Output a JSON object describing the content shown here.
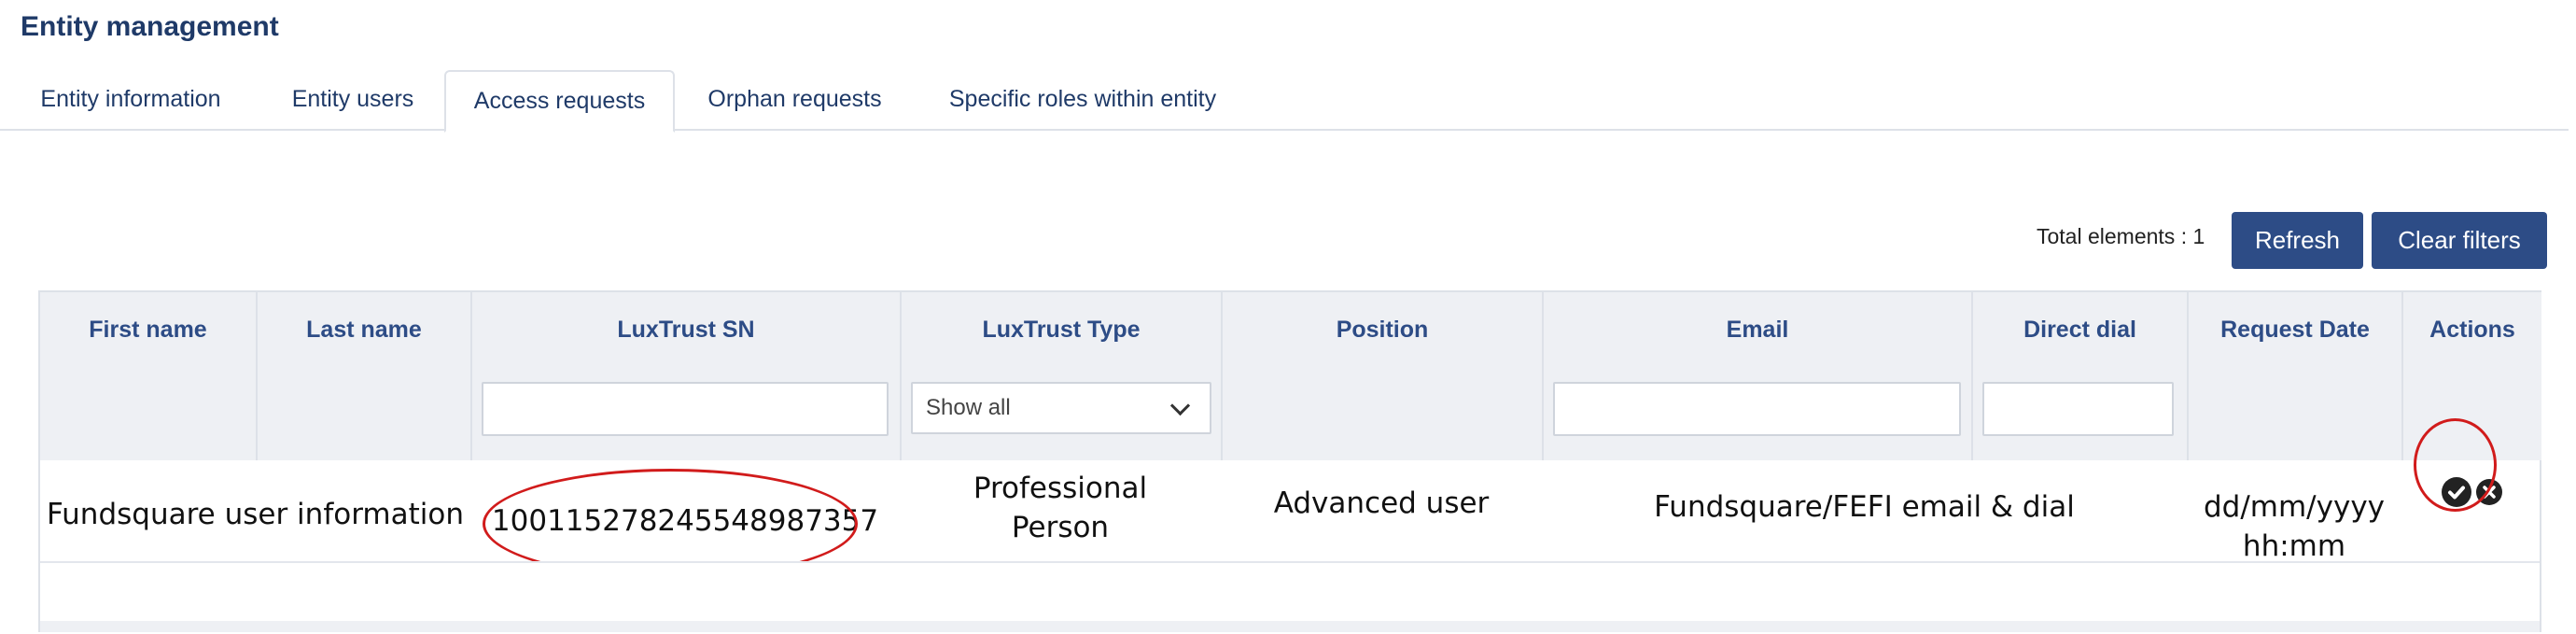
{
  "page": {
    "title": "Entity management"
  },
  "tabs": [
    {
      "label": "Entity information",
      "active": false
    },
    {
      "label": "Entity users",
      "active": false
    },
    {
      "label": "Access requests",
      "active": true
    },
    {
      "label": "Orphan requests",
      "active": false
    },
    {
      "label": "Specific roles within entity",
      "active": false
    }
  ],
  "toolbar": {
    "total_label": "Total elements : 1",
    "refresh_label": "Refresh",
    "clear_filters_label": "Clear filters"
  },
  "table": {
    "columns": [
      "First name",
      "Last name",
      "LuxTrust SN",
      "LuxTrust Type",
      "Position",
      "Email",
      "Direct dial",
      "Request Date",
      "Actions"
    ],
    "filters": {
      "luxtrust_sn": "",
      "luxtrust_type": "Show all",
      "email": "",
      "direct_dial": ""
    },
    "rows": [
      {
        "first_name": "Fundsquare user information",
        "luxtrust_sn": "100115278245548987357",
        "luxtrust_type_line1": "Professional",
        "luxtrust_type_line2": "Person",
        "position": "Advanced user",
        "email": "Fundsquare/FEFI email & dial",
        "request_date_line1": "dd/mm/yyyy",
        "request_date_line2": "hh:mm"
      }
    ]
  },
  "icons": {
    "approve": "check-circle-icon",
    "reject": "x-circle-icon"
  },
  "colors": {
    "primary": "#2d4c86",
    "highlight": "#d11b1b"
  }
}
